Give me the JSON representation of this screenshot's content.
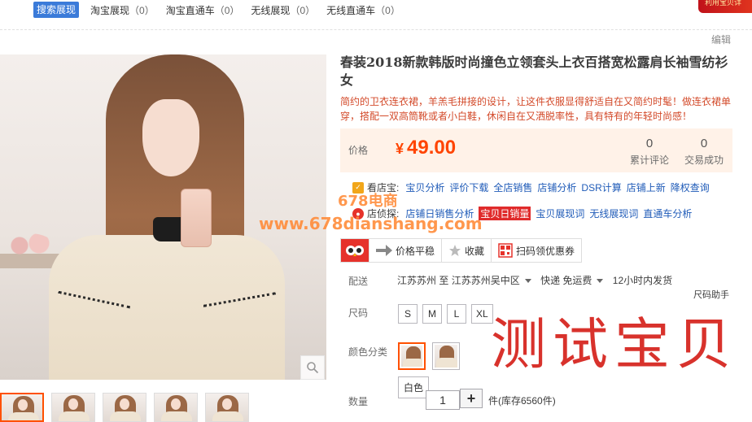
{
  "topbar": {
    "search_tag": "搜索展现",
    "items": [
      {
        "label": "淘宝展现",
        "count": "（0）"
      },
      {
        "label": "淘宝直通车",
        "count": "（0）"
      },
      {
        "label": "无线展现",
        "count": "（0）"
      },
      {
        "label": "无线直通车",
        "count": "（0）"
      }
    ],
    "banner_text": "利用宝贝详"
  },
  "edit_label": "编辑",
  "product": {
    "title": "春装2018新款韩版时尚撞色立领套头上衣百搭宽松露肩长袖雪纺衫女",
    "subtitle": "简约的卫衣连衣裙，羊羔毛拼接的设计，让这件衣服显得舒适自在又简约时髦！做连衣裙单穿，搭配一双高筒靴或者小白鞋，休闲自在又洒脱率性，具有特有的年轻时尚感！"
  },
  "price": {
    "label": "价格",
    "currency": "¥",
    "value": "49.00",
    "reviews_num": "0",
    "reviews_label": "累计评论",
    "deals_num": "0",
    "deals_label": "交易成功"
  },
  "tools_row1": {
    "lead": "看店宝:",
    "links": [
      "宝贝分析",
      "评价下载",
      "全店销售",
      "店铺分析",
      "DSR计算",
      "店铺上新",
      "降权查询"
    ]
  },
  "tools_row2": {
    "lead": "店侦探:",
    "links": [
      "店铺日销售分析",
      "宝贝日销量",
      "宝贝展现词",
      "无线展现词",
      "直通车分析"
    ]
  },
  "watermark": {
    "line1": "678电商",
    "line2": "www.678dianshang.com"
  },
  "action_bar": {
    "price_trend": "价格平稳",
    "favorite": "收藏",
    "coupon": "扫码领优惠券"
  },
  "shipping": {
    "label": "配送",
    "from": "江苏苏州",
    "to_word": "至",
    "to": "江苏苏州吴中区",
    "method": "快递 免运费",
    "dispatch": "12小时内发货"
  },
  "size": {
    "label": "尺码",
    "helper": "尺码助手",
    "options": [
      "S",
      "M",
      "L",
      "XL"
    ]
  },
  "color": {
    "label": "颜色分类",
    "tooltip": "白色"
  },
  "quantity": {
    "label": "数量",
    "value": "1",
    "plus": "+",
    "stock": "件(库存6560件)"
  },
  "handwriting_text": "测试宝贝",
  "colors": {
    "accent": "#ff4400",
    "price_bg": "#fff2e8",
    "link": "#1f5bb8",
    "tag_blue": "#3b7bd9"
  }
}
